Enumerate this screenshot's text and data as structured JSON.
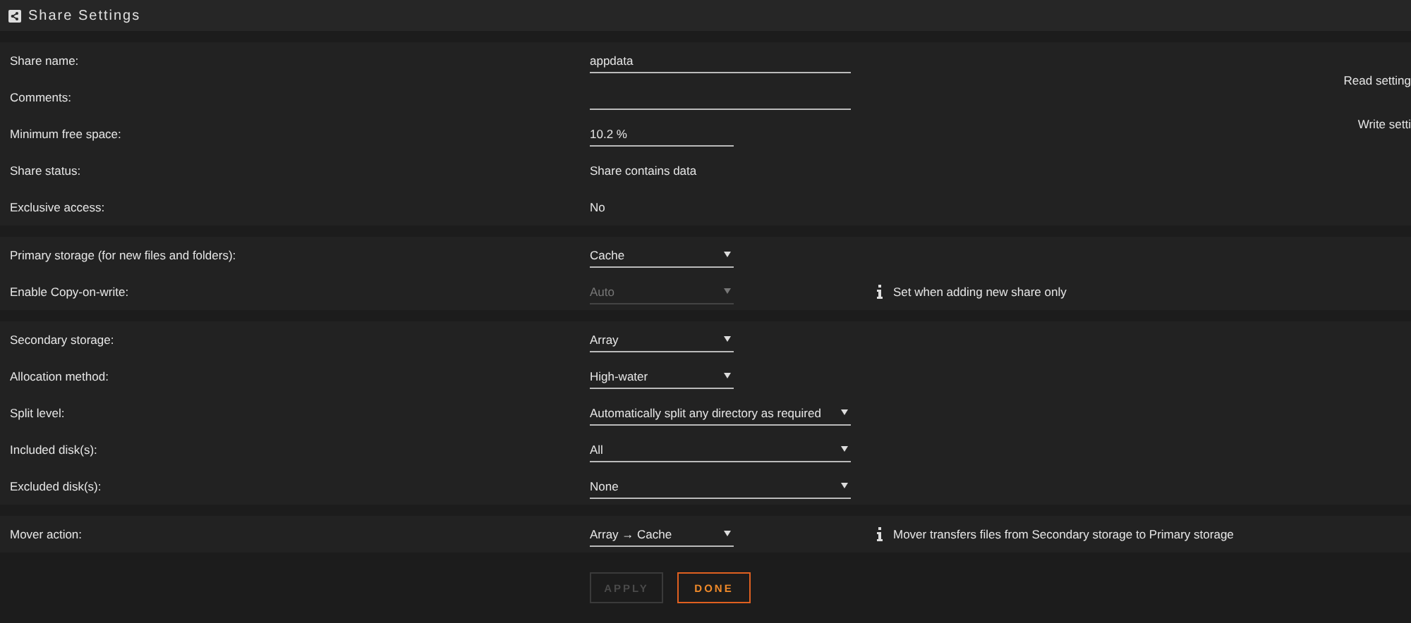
{
  "window": {
    "title": "Share Settings"
  },
  "sections": [
    {
      "rows": [
        {
          "label": "Share name:",
          "kind": "input",
          "value": "appdata",
          "wide": true
        },
        {
          "label": "Comments:",
          "kind": "input",
          "value": "",
          "wide": true
        },
        {
          "label": "Minimum free space:",
          "kind": "input",
          "value": "10.2 %",
          "wide": false
        },
        {
          "label": "Share status:",
          "kind": "text",
          "value": "Share contains data"
        },
        {
          "label": "Exclusive access:",
          "kind": "text",
          "value": "No"
        }
      ],
      "side": [
        "Read setting",
        "Write setti"
      ]
    },
    {
      "rows": [
        {
          "label": "Primary storage (for new files and folders):",
          "kind": "select",
          "value": "Cache",
          "wide": false,
          "disabled": false
        },
        {
          "label": "Enable Copy-on-write:",
          "kind": "select",
          "value": "Auto",
          "wide": false,
          "disabled": true,
          "note": "Set when adding new share only"
        }
      ]
    },
    {
      "rows": [
        {
          "label": "Secondary storage:",
          "kind": "select",
          "value": "Array",
          "wide": false,
          "disabled": false
        },
        {
          "label": "Allocation method:",
          "kind": "select",
          "value": "High-water",
          "wide": false,
          "disabled": false
        },
        {
          "label": "Split level:",
          "kind": "select",
          "value": "Automatically split any directory as required",
          "wide": true,
          "disabled": false
        },
        {
          "label": "Included disk(s):",
          "kind": "select",
          "value": "All",
          "wide": true,
          "disabled": false
        },
        {
          "label": "Excluded disk(s):",
          "kind": "select",
          "value": "None",
          "wide": true,
          "disabled": false
        }
      ]
    },
    {
      "rows": [
        {
          "label": "Mover action:",
          "kind": "select",
          "value": "Array → Cache",
          "wide": false,
          "disabled": false,
          "note": "Mover transfers files from Secondary storage to Primary storage"
        }
      ]
    }
  ],
  "buttons": [
    {
      "label": "APPLY",
      "disabled": true
    },
    {
      "label": "DONE",
      "disabled": false
    }
  ]
}
